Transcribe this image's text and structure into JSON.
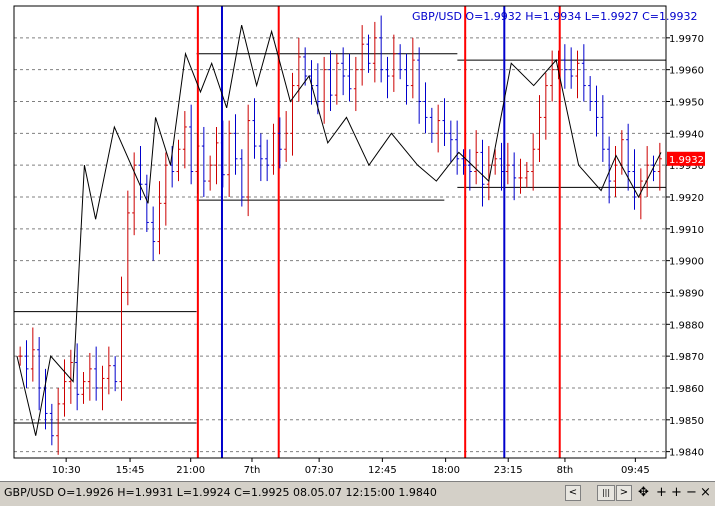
{
  "chart_data": {
    "type": "ohlc",
    "symbol_header": "GBP/USD O=1.9932 H=1.9934 L=1.9927 C=1.9932",
    "last_price_label": "1.9932",
    "ylim": [
      1.9838,
      1.998
    ],
    "y_ticks": [
      "1.9970",
      "1.9960",
      "1.9950",
      "1.9940",
      "1.9930",
      "1.9920",
      "1.9910",
      "1.9900",
      "1.9890",
      "1.9880",
      "1.9870",
      "1.9860",
      "1.9850",
      "1.9840"
    ],
    "x_ticks": [
      "10:30",
      "15:45",
      "21:00",
      "7th",
      "07:30",
      "12:45",
      "18:00",
      "23:15",
      "8th",
      "09:45"
    ],
    "grid": true,
    "bars": [
      1.987,
      1.9866,
      1.9872,
      1.986,
      1.9852,
      1.9845,
      1.9855,
      1.9862,
      1.9868,
      1.9858,
      1.9862,
      1.9866,
      1.986,
      1.9863,
      1.9867,
      1.9862,
      1.989,
      1.9915,
      1.993,
      1.9924,
      1.9912,
      1.9906,
      1.9918,
      1.993,
      1.9928,
      1.9935,
      1.9942,
      1.9928,
      1.9936,
      1.9925,
      1.993,
      1.9937,
      1.9927,
      1.994,
      1.9932,
      1.992,
      1.9944,
      1.9936,
      1.9932,
      1.993,
      1.994,
      1.9935,
      1.994,
      1.9955,
      1.9964,
      1.9958,
      1.9955,
      1.995,
      1.996,
      1.9952,
      1.9962,
      1.9958,
      1.9954,
      1.996,
      1.9968,
      1.9962,
      1.997,
      1.996,
      1.9958,
      1.9965,
      1.996,
      1.9955,
      1.9963,
      1.995,
      1.9945,
      1.994,
      1.9944,
      1.994,
      1.9938,
      1.9932,
      1.993,
      1.9928,
      1.9934,
      1.9924,
      1.993,
      1.9932,
      1.9928,
      1.993,
      1.9926,
      1.9926,
      1.9928,
      1.9935,
      1.9945,
      1.9955,
      1.996,
      1.9963,
      1.996,
      1.9958,
      1.9962,
      1.9955,
      1.995,
      1.9945,
      1.9935,
      1.9925,
      1.993,
      1.9938,
      1.9928,
      1.992,
      1.9925,
      1.993,
      1.9928,
      1.9932
    ],
    "zigzag": [
      [
        0,
        1.987
      ],
      [
        5,
        1.9845
      ],
      [
        9,
        1.987
      ],
      [
        15,
        1.9862
      ],
      [
        18,
        1.993
      ],
      [
        21,
        1.9913
      ],
      [
        26,
        1.9942
      ],
      [
        35,
        1.9918
      ],
      [
        37,
        1.9945
      ],
      [
        41,
        1.993
      ],
      [
        45,
        1.9965
      ],
      [
        49,
        1.9953
      ],
      [
        52,
        1.9962
      ],
      [
        56,
        1.9948
      ],
      [
        60,
        1.9974
      ],
      [
        64,
        1.9955
      ],
      [
        68,
        1.9972
      ],
      [
        73,
        1.995
      ],
      [
        78,
        1.9958
      ],
      [
        83,
        1.9937
      ],
      [
        88,
        1.9945
      ],
      [
        94,
        1.993
      ],
      [
        100,
        1.994
      ],
      [
        107,
        1.993
      ],
      [
        112,
        1.9925
      ],
      [
        118,
        1.9934
      ],
      [
        126,
        1.9925
      ],
      [
        132,
        1.9962
      ],
      [
        138,
        1.9955
      ],
      [
        144,
        1.9963
      ],
      [
        150,
        1.993
      ],
      [
        156,
        1.9922
      ],
      [
        160,
        1.9933
      ],
      [
        166,
        1.992
      ],
      [
        172,
        1.9934
      ]
    ],
    "zigzag_index_max": 172,
    "hlines": [
      {
        "y": 1.9884,
        "from": 0.0,
        "to": 0.28
      },
      {
        "y": 1.9849,
        "from": 0.0,
        "to": 0.28
      },
      {
        "y": 1.9965,
        "from": 0.28,
        "to": 0.68
      },
      {
        "y": 1.9919,
        "from": 0.28,
        "to": 0.66
      },
      {
        "y": 1.9963,
        "from": 0.68,
        "to": 1.0
      },
      {
        "y": 1.9923,
        "from": 0.68,
        "to": 1.0
      }
    ],
    "vlines": [
      {
        "at": 0.282,
        "color": "#ff0000"
      },
      {
        "at": 0.319,
        "color": "#0000cc"
      },
      {
        "at": 0.406,
        "color": "#ff0000"
      },
      {
        "at": 0.692,
        "color": "#ff0000"
      },
      {
        "at": 0.752,
        "color": "#0000cc"
      },
      {
        "at": 0.837,
        "color": "#ff0000"
      }
    ],
    "colors": {
      "up": "#cc0000",
      "down": "#0000cc",
      "zigzag": "#000000",
      "grid": "#808080",
      "axis": "#000000",
      "price_tag": "#ff0000"
    }
  },
  "status_bar": {
    "text": "GBP/USD O=1.9926 H=1.9931 L=1.9924 C=1.9925  08.05.07 12:15:00 1.9840",
    "buttons": [
      "<",
      "|||",
      ">"
    ],
    "tools": [
      "✥",
      "+",
      "+",
      "−",
      "×"
    ]
  }
}
